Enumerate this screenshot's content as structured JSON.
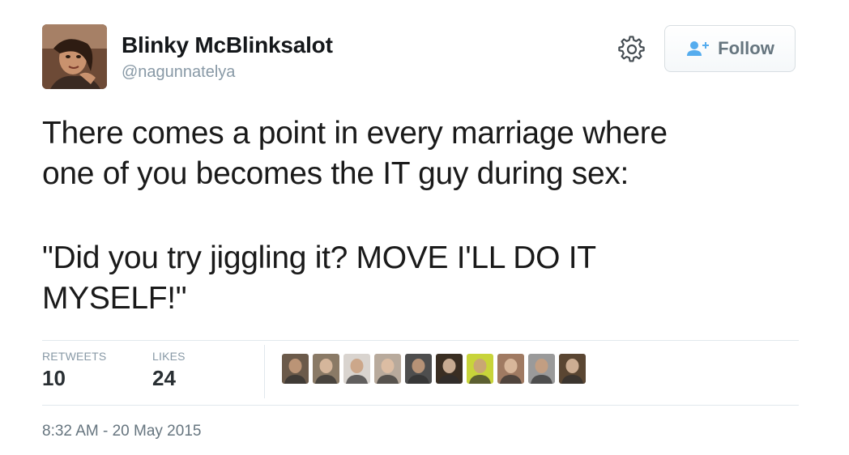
{
  "user": {
    "name": "Blinky McBlinksalot",
    "handle": "@nagunnatelya"
  },
  "header": {
    "follow_label": "Follow",
    "settings_icon": "gear-icon",
    "follow_icon": "add-user-icon"
  },
  "tweet": {
    "paragraphs": [
      "There comes a point in every marriage where\none of you becomes the IT guy during sex:",
      "\"Did you try jiggling it? MOVE I'LL DO IT\nMYSELF!\""
    ]
  },
  "stats": {
    "retweets_label": "RETWEETS",
    "retweets_value": "10",
    "likes_label": "LIKES",
    "likes_value": "24"
  },
  "likers": {
    "count": 10,
    "colors": [
      "#6b5a4a",
      "#8a7a66",
      "#d9d4cf",
      "#b8aa9c",
      "#4e4e4e",
      "#3a2e22",
      "#c8d43a",
      "#a07a62",
      "#9a9a9a",
      "#5a4632"
    ]
  },
  "timestamp": "8:32 AM - 20 May 2015"
}
